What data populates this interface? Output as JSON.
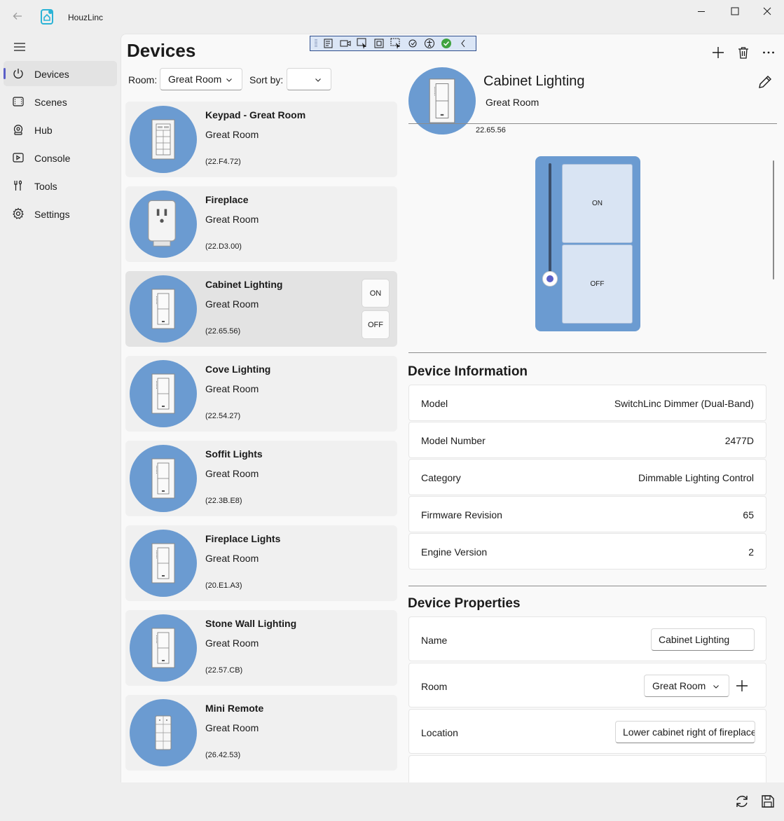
{
  "app": {
    "title": "HouzLinc"
  },
  "sidebar": {
    "items": [
      {
        "label": "Devices",
        "icon": "power-icon"
      },
      {
        "label": "Scenes",
        "icon": "scenes-icon"
      },
      {
        "label": "Hub",
        "icon": "hub-icon"
      },
      {
        "label": "Console",
        "icon": "console-icon"
      },
      {
        "label": "Tools",
        "icon": "tools-icon"
      },
      {
        "label": "Settings",
        "icon": "gear-icon"
      }
    ],
    "selected": "Devices"
  },
  "page": {
    "title": "Devices"
  },
  "filters": {
    "room_label": "Room:",
    "room_value": "Great Room",
    "sort_label": "Sort by:",
    "sort_value": ""
  },
  "devices": [
    {
      "name": "Keypad - Great Room",
      "room": "Great Room",
      "address": "(22.F4.72)",
      "type": "keypad"
    },
    {
      "name": "Fireplace",
      "room": "Great Room",
      "address": "(22.D3.00)",
      "type": "outlet"
    },
    {
      "name": "Cabinet Lighting",
      "room": "Great Room",
      "address": "(22.65.56)",
      "type": "switch",
      "selected": true,
      "on_label": "ON",
      "off_label": "OFF"
    },
    {
      "name": "Cove Lighting",
      "room": "Great Room",
      "address": "(22.54.27)",
      "type": "switch"
    },
    {
      "name": "Soffit Lights",
      "room": "Great Room",
      "address": "(22.3B.E8)",
      "type": "switch"
    },
    {
      "name": "Fireplace Lights",
      "room": "Great Room",
      "address": "(20.E1.A3)",
      "type": "switch"
    },
    {
      "name": "Stone Wall Lighting",
      "room": "Great Room",
      "address": "(22.57.CB)",
      "type": "switch"
    },
    {
      "name": "Mini Remote",
      "room": "Great Room",
      "address": "(26.42.53)",
      "type": "remote"
    }
  ],
  "detail": {
    "name": "Cabinet Lighting",
    "room": "Great Room",
    "address": "22.65.56",
    "switch": {
      "on_label": "ON",
      "off_label": "OFF",
      "level": 0
    },
    "info_title": "Device Information",
    "info": [
      {
        "key": "Model",
        "value": "SwitchLinc Dimmer (Dual-Band)"
      },
      {
        "key": "Model Number",
        "value": "2477D"
      },
      {
        "key": "Category",
        "value": "Dimmable Lighting Control"
      },
      {
        "key": "Firmware Revision",
        "value": "65"
      },
      {
        "key": "Engine Version",
        "value": "2"
      }
    ],
    "props_title": "Device Properties",
    "props": {
      "name_label": "Name",
      "name_value": "Cabinet Lighting",
      "room_label": "Room",
      "room_value": "Great Room",
      "location_label": "Location",
      "location_value": "Lower cabinet right of fireplace"
    }
  },
  "colors": {
    "accent": "#5b5fc7",
    "device_circle": "#6b9bd1",
    "paddle": "#d9e4f3"
  }
}
